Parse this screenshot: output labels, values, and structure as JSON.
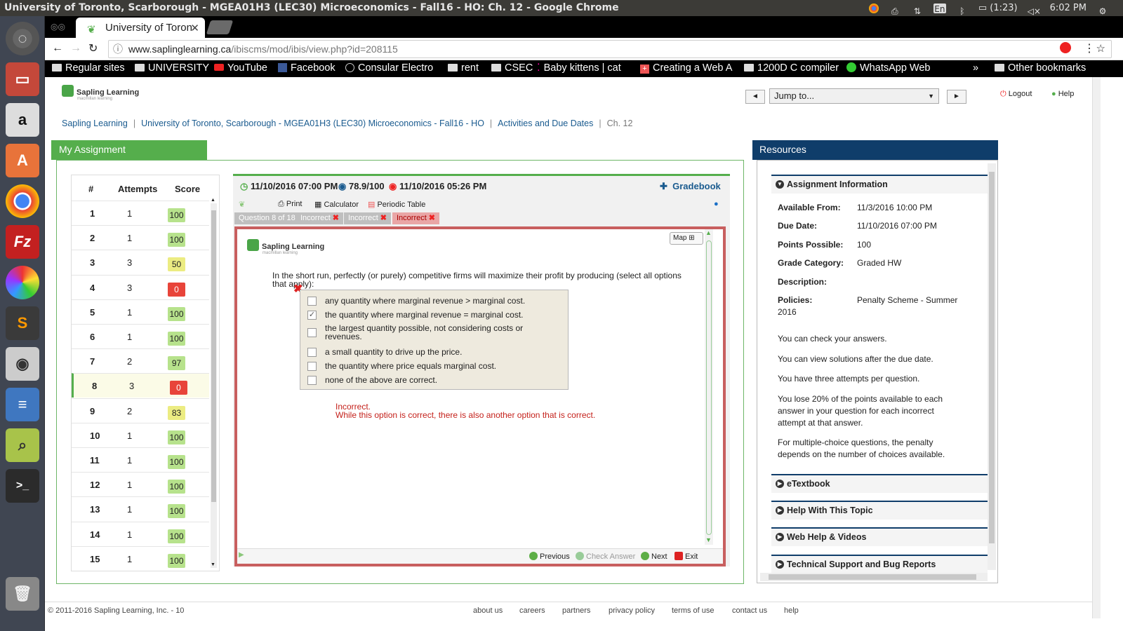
{
  "system_bar": {
    "window_title": "University of Toronto, Scarborough - MGEA01H3 (LEC30) Microeconomics - Fall16 - HO: Ch. 12 - Google Chrome",
    "keyboard": "En",
    "battery": "(1:23)",
    "time": "6:02 PM"
  },
  "browser": {
    "tab_title": "University of Toron",
    "url_host": "www.saplinglearning.ca",
    "url_path": "/ibiscms/mod/ibis/view.php?id=208115",
    "bookmarks": [
      "Regular sites",
      "UNIVERSITY",
      "YouTube",
      "Facebook",
      "Consular Electro",
      "rent",
      "CSEC",
      "Baby kittens | cat",
      "Creating a Web A",
      "1200D C compiler",
      "WhatsApp Web"
    ],
    "overflow": "»",
    "other_bookmarks": "Other bookmarks"
  },
  "header": {
    "logo": "Sapling Learning",
    "logo_sub": "macmillan learning",
    "jump_to": "Jump to...",
    "prev_arrow": "◄",
    "next_arrow": "►",
    "logout": "Logout",
    "help": "Help"
  },
  "breadcrumb": {
    "items": [
      "Sapling Learning",
      "University of Toronto, Scarborough - MGEA01H3 (LEC30) Microeconomics - Fall16 - HO",
      "Activities and Due Dates"
    ],
    "current": "Ch. 12",
    "separator": "|"
  },
  "assignment": {
    "title": "My Assignment",
    "columns": [
      "#",
      "Attempts",
      "Score"
    ],
    "rows": [
      {
        "n": "1",
        "attempts": "1",
        "score": "100",
        "color": "g"
      },
      {
        "n": "2",
        "attempts": "1",
        "score": "100",
        "color": "g"
      },
      {
        "n": "3",
        "attempts": "3",
        "score": "50",
        "color": "y"
      },
      {
        "n": "4",
        "attempts": "3",
        "score": "0",
        "color": "r"
      },
      {
        "n": "5",
        "attempts": "1",
        "score": "100",
        "color": "g"
      },
      {
        "n": "6",
        "attempts": "1",
        "score": "100",
        "color": "g"
      },
      {
        "n": "7",
        "attempts": "2",
        "score": "97",
        "color": "g"
      },
      {
        "n": "8",
        "attempts": "3",
        "score": "0",
        "color": "r"
      },
      {
        "n": "9",
        "attempts": "2",
        "score": "83",
        "color": "y"
      },
      {
        "n": "10",
        "attempts": "1",
        "score": "100",
        "color": "g"
      },
      {
        "n": "11",
        "attempts": "1",
        "score": "100",
        "color": "g"
      },
      {
        "n": "12",
        "attempts": "1",
        "score": "100",
        "color": "g"
      },
      {
        "n": "13",
        "attempts": "1",
        "score": "100",
        "color": "g"
      },
      {
        "n": "14",
        "attempts": "1",
        "score": "100",
        "color": "g"
      },
      {
        "n": "15",
        "attempts": "1",
        "score": "100",
        "color": "g"
      }
    ],
    "selected_row": "8"
  },
  "question": {
    "due": "11/10/2016 07:00 PM",
    "grade": "78.9/100",
    "last_saved": "11/10/2016 05:26 PM",
    "gradebook": "Gradebook",
    "tools": {
      "print": "Print",
      "calculator": "Calculator",
      "periodic": "Periodic Table"
    },
    "tabs": [
      "Question 8 of 18",
      "Incorrect",
      "Incorrect",
      "Incorrect"
    ],
    "map": "Map",
    "logo": "Sapling Learning",
    "logo_sub": "macmillan learning",
    "prompt_line1": "In the short run, perfectly (or purely) competitive firms will maximize their profit by producing (select all options",
    "prompt_line2": "that apply):",
    "options": [
      {
        "text": "any quantity where marginal revenue > marginal cost.",
        "checked": false
      },
      {
        "text": "the quantity where marginal revenue = marginal cost.",
        "checked": true
      },
      {
        "text": "the largest quantity possible, not considering costs or",
        "text2": "revenues.",
        "checked": false
      },
      {
        "text": "a small quantity to drive up the price.",
        "checked": false
      },
      {
        "text": "the quantity where price equals marginal cost.",
        "checked": false
      },
      {
        "text": "none of the above are correct.",
        "checked": false
      }
    ],
    "feedback_title": "Incorrect.",
    "feedback_body": "While this option is correct, there is also another option that is correct.",
    "buttons": {
      "previous": "Previous",
      "check": "Check Answer",
      "next": "Next",
      "exit": "Exit"
    }
  },
  "resources": {
    "title": "Resources",
    "sections": [
      "Assignment Information",
      "eTextbook",
      "Help With This Topic",
      "Web Help & Videos",
      "Technical Support and Bug Reports"
    ],
    "info": {
      "available_from_label": "Available From:",
      "available_from": "11/3/2016 10:00 PM",
      "due_label": "Due Date:",
      "due": "11/10/2016 07:00 PM",
      "points_label": "Points Possible:",
      "points": "100",
      "grade_cat_label": "Grade Category:",
      "grade_cat": "Graded HW",
      "desc_label": "Description:",
      "policies_label": "Policies:",
      "policies": "Penalty Scheme - Summer",
      "policies_year": "2016"
    },
    "notes": [
      "You can check your answers.",
      "You can view solutions after the due date.",
      "You have three attempts per question.",
      "You lose 20% of the points available to each answer in your question for each incorrect attempt at that answer.",
      "For multiple-choice questions, the penalty depends on the number of choices available."
    ]
  },
  "footer": {
    "copyright": "© 2011-2016 Sapling Learning, Inc. - 10",
    "links": [
      "about us",
      "careers",
      "partners",
      "privacy policy",
      "terms of use",
      "contact us",
      "help"
    ]
  }
}
